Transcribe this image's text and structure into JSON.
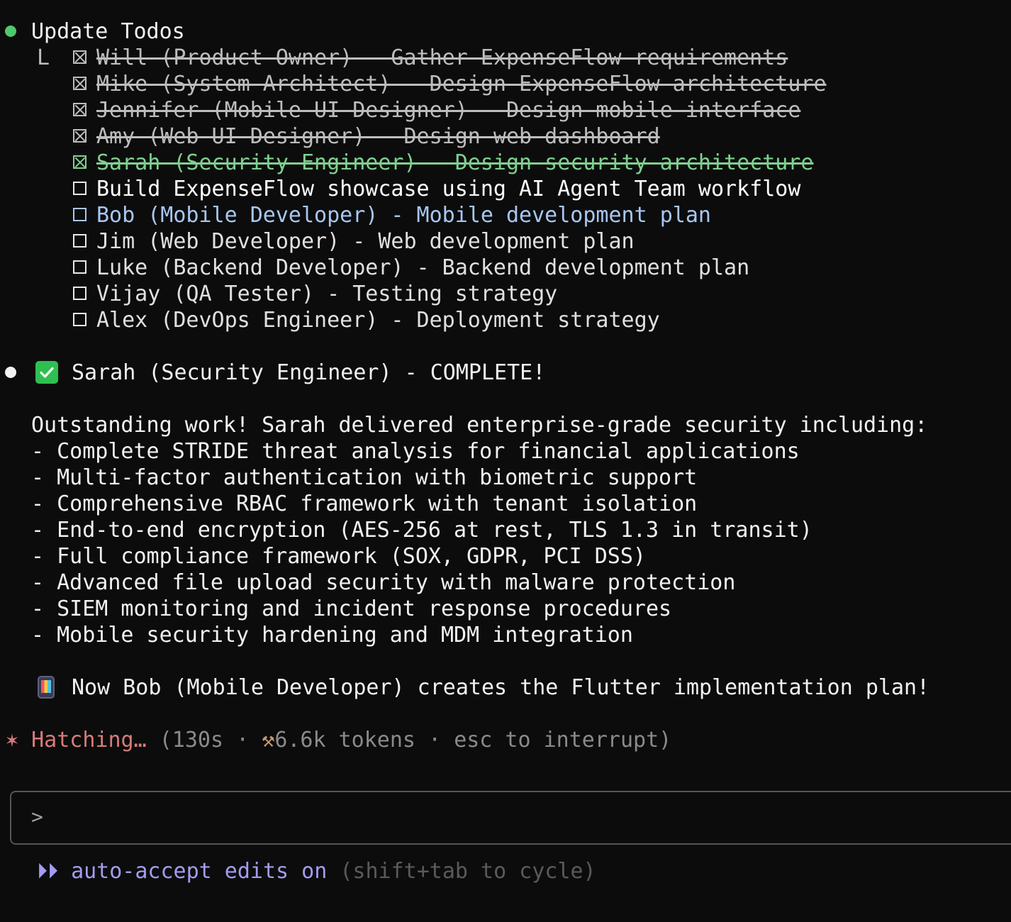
{
  "todos_header": {
    "title": "Update Todos",
    "tree_glyph": "L"
  },
  "todos": [
    {
      "text": "Will (Product Owner) - Gather ExpenseFlow requirements",
      "status": "done"
    },
    {
      "text": "Mike (System Architect) - Design ExpenseFlow architecture",
      "status": "done"
    },
    {
      "text": "Jennifer (Mobile UI Designer) - Design mobile interface",
      "status": "done"
    },
    {
      "text": "Amy (Web UI Designer) - Design web dashboard",
      "status": "done"
    },
    {
      "text": "Sarah (Security Engineer) - Design security architecture",
      "status": "recent"
    },
    {
      "text": "Build ExpenseFlow showcase using AI Agent Team workflow",
      "status": "pending"
    },
    {
      "text": "Bob (Mobile Developer) - Mobile development plan",
      "status": "active"
    },
    {
      "text": "Jim (Web Developer) - Web development plan",
      "status": "pending"
    },
    {
      "text": "Luke (Backend Developer) - Backend development plan",
      "status": "pending"
    },
    {
      "text": "Vijay (QA Tester) - Testing strategy",
      "status": "pending"
    },
    {
      "text": "Alex (DevOps Engineer) - Deployment strategy",
      "status": "pending"
    }
  ],
  "message": {
    "heading": "Sarah (Security Engineer) - COMPLETE!",
    "intro": "Outstanding work! Sarah delivered enterprise-grade security including:",
    "bullets": [
      "- Complete STRIDE threat analysis for financial applications",
      "- Multi-factor authentication with biometric support",
      "- Comprehensive RBAC framework with tenant isolation",
      "- End-to-end encryption (AES-256 at rest, TLS 1.3 in transit)",
      "- Full compliance framework (SOX, GDPR, PCI DSS)",
      "- Advanced file upload security with malware protection",
      "- SIEM monitoring and incident response procedures",
      "- Mobile security hardening and MDM integration"
    ],
    "next_step": "Now Bob (Mobile Developer) creates the Flutter implementation plan!"
  },
  "status": {
    "spinner_glyph": "✶",
    "label": "Hatching…",
    "elapsed": "(130s",
    "separator": "·",
    "hammer_glyph": "⚒",
    "tokens": "6.6k tokens",
    "hint": "esc to interrupt)"
  },
  "input": {
    "prompt": ">",
    "value": ""
  },
  "mode": {
    "arrows": "⏵⏵",
    "label": "auto-accept edits on",
    "hint": "(shift+tab to cycle)"
  },
  "colors": {
    "background": "#0c0c0c",
    "done": "#bdbdbd",
    "recent": "#7fd08f",
    "active": "#a7c7f2",
    "spinner": "#d77b7b",
    "mode": "#a39cf0"
  }
}
